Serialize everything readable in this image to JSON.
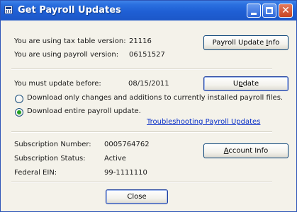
{
  "window": {
    "title": "Get Payroll Updates"
  },
  "versions": {
    "tax_table_label": "You are using tax table version:",
    "tax_table_value": "21116",
    "payroll_label": "You are using payroll version:",
    "payroll_value": "06151527",
    "info_button_pre": "Payroll Update ",
    "info_button_key": "I",
    "info_button_post": "nfo"
  },
  "update": {
    "deadline_label": "You must update before:",
    "deadline_value": "08/15/2011",
    "update_button_pre": "U",
    "update_button_key": "p",
    "update_button_post": "date",
    "option_changes_label": "Download only changes and additions to currently installed payroll files.",
    "option_entire_label": "Download entire payroll update.",
    "selected_option": "entire",
    "troubleshooting_link": "Troubleshooting Payroll Updates"
  },
  "subscription": {
    "number_label": "Subscription Number:",
    "number_value": "0005764762",
    "status_label": "Subscription Status:",
    "status_value": "Active",
    "ein_label": "Federal EIN:",
    "ein_value": "99-1111110",
    "account_button_pre": "",
    "account_button_key": "A",
    "account_button_post": "ccount Info"
  },
  "footer": {
    "close_label": "Close"
  }
}
